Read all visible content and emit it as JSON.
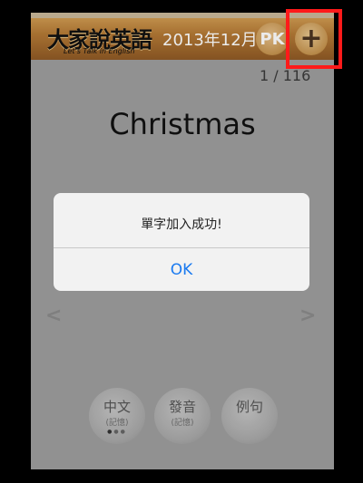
{
  "header": {
    "logo_title": "大家說英語",
    "logo_subtitle": "Let's Talk in English",
    "issue_date": "2013年12月",
    "pk_label": "PK",
    "add_label": "+"
  },
  "card": {
    "counter": "1  / 116",
    "word": "Christmas"
  },
  "nav": {
    "prev": "<",
    "next": ">"
  },
  "buttons": {
    "chinese": {
      "label": "中文",
      "sub": "(記憶)"
    },
    "pronunciation": {
      "label": "發音",
      "sub": "(記憶)"
    },
    "example": {
      "label": "例句"
    }
  },
  "alert": {
    "message": "單字加入成功!",
    "ok_label": "OK"
  },
  "colors": {
    "highlight": "#ff1a1a",
    "ok_blue": "#1a7af0"
  }
}
